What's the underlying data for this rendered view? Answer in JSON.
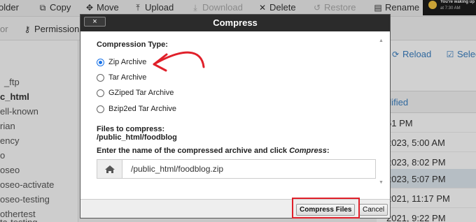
{
  "toolbar": {
    "items": [
      {
        "icon": "folder",
        "label": "older"
      },
      {
        "icon": "copy",
        "label": "Copy"
      },
      {
        "icon": "move",
        "label": "Move"
      },
      {
        "icon": "upload",
        "label": "Upload"
      },
      {
        "icon": "download",
        "label": "Download"
      },
      {
        "icon": "delete",
        "label": "Delete"
      },
      {
        "icon": "restore",
        "label": "Restore"
      },
      {
        "icon": "rename",
        "label": "Rename"
      }
    ],
    "notification": {
      "line1": "You're waking up",
      "line2": "at 7:30 AM"
    }
  },
  "bar2": {
    "left_text": "or",
    "permissions": "Permission"
  },
  "tree": {
    "items": [
      "_ftp",
      "c_html",
      "ell-known",
      "rian",
      "ency",
      "o",
      "oseo",
      "oseo-activate",
      "oseo-testing",
      "othertest",
      "ta-testing"
    ]
  },
  "right_panel": {
    "reload": "Reload",
    "select": "Selec",
    "column_header": "dified",
    "rows": [
      "51 PM",
      "2023, 5:00 AM",
      "2023, 8:02 PM",
      "2023, 5:07 PM",
      "2021, 11:17 PM",
      "2021, 9:22 PM"
    ]
  },
  "dialog": {
    "title": "Compress",
    "close_label": "×",
    "compression_type_label": "Compression Type:",
    "options": [
      {
        "label": "Zip Archive",
        "checked": true
      },
      {
        "label": "Tar Archive",
        "checked": false
      },
      {
        "label": "GZiped Tar Archive",
        "checked": false
      },
      {
        "label": "Bzip2ed Tar Archive",
        "checked": false
      }
    ],
    "files_label": "Files to compress:",
    "files_path": "/public_html/foodblog",
    "enter_label_prefix": "Enter the name of the compressed archive and click ",
    "enter_label_emph": "Compress",
    "enter_label_suffix": ":",
    "archive_name": "/public_html/foodblog.zip",
    "compress_button": "Compress Files",
    "cancel_button": "Cancel"
  },
  "colors": {
    "accent": "#1a73e8",
    "highlight": "#e0202a",
    "header": "#2b2b2b",
    "link": "#3a7fc1"
  }
}
